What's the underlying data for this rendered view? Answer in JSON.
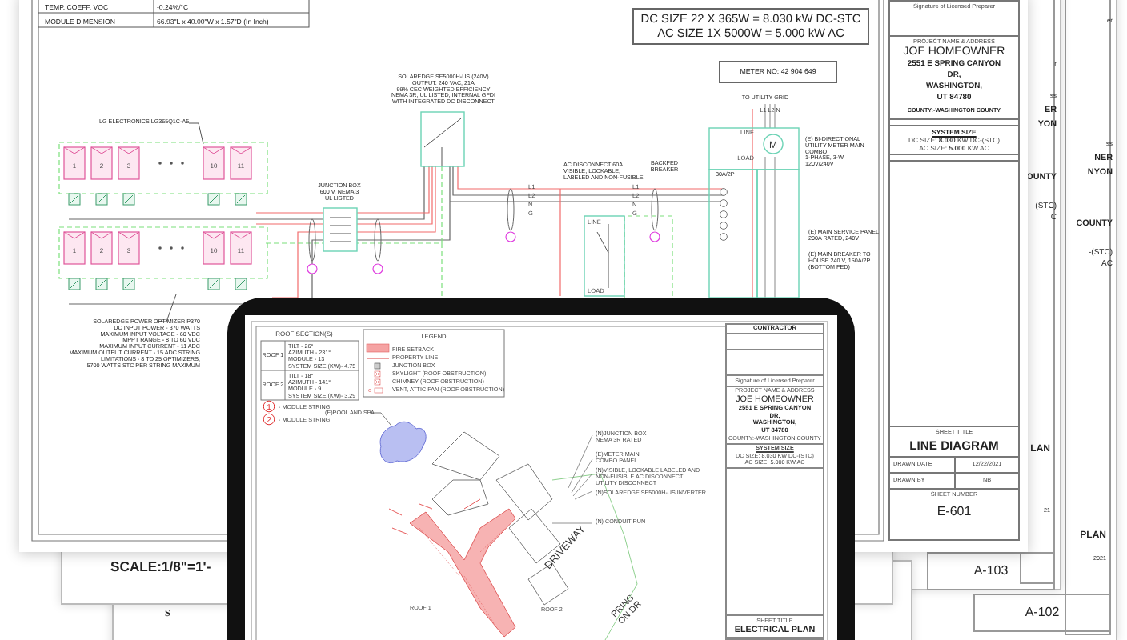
{
  "back_sheets": [
    {
      "fragments": [
        "er",
        "ss",
        "NER",
        "NYON",
        "COUNTY",
        "-(STC)",
        "AC"
      ],
      "title_fragment": "PLAN",
      "date_fragment": "2021",
      "sheet_number": "A-102"
    },
    {
      "fragments": [
        "r",
        "ss",
        "ER",
        "YON",
        "OUNTY",
        "(STC)",
        "C"
      ],
      "title_fragment": "LAN",
      "date_fragment": "21",
      "sheet_number": "A-103"
    }
  ],
  "lower_sheets": {
    "scale_note": "SCALE:1/8\"=1'-",
    "north_mark": "S"
  },
  "line_diagram": {
    "spec_table": [
      {
        "parameter": "TEMP. COEFF. VOC",
        "value": "-0.24%/°C"
      },
      {
        "parameter": "MODULE DIMENSION",
        "value": "66.93\"L x 40.00\"W x 1.57\"D (In Inch)"
      }
    ],
    "system_sizes": [
      "DC SIZE 22 X 365W = 8.030 kW DC-STC",
      "AC SIZE 1X 5000W = 5.000 kW AC"
    ],
    "meter_number": "METER NO: 42 904 649",
    "module_rows": [
      [
        "1",
        "2",
        "3",
        "10",
        "11"
      ],
      [
        "1",
        "2",
        "3",
        "10",
        "11"
      ]
    ],
    "notes": [
      {
        "lines": [
          "LG ELECTRONICS LG365Q1C-A5"
        ]
      },
      {
        "lines": [
          "SOLAREDGE SE5000H-US (240V)",
          "OUTPUT: 240 VAC, 21A",
          "99% CEC WEIGHTED EFFICIENCY",
          "NEMA 3R, UL LISTED, INTERNAL GFDI",
          "WITH INTEGRATED DC DISCONNECT"
        ]
      },
      {
        "lines": [
          "JUNCTION BOX",
          "600 V, NEMA 3",
          "UL LISTED"
        ]
      },
      {
        "lines": [
          "AC DISCONNECT 60A",
          "VISIBLE, LOCKABLE,",
          "LABELED AND NON-FUSIBLE"
        ]
      },
      {
        "lines": [
          "TO UTILITY GRID"
        ]
      },
      {
        "lines": [
          "BACKFED",
          "BREAKER"
        ]
      },
      {
        "lines": [
          "(E) BI-DIRECTIONAL",
          "UTILITY METER MAIN",
          "COMBO",
          "1-PHASE, 3-W,",
          "120V/240V"
        ]
      },
      {
        "lines": [
          "(E) MAIN SERVICE PANEL",
          "200A RATED, 240V"
        ]
      },
      {
        "lines": [
          "(E) MAIN BREAKER TO",
          "HOUSE 240 V, 150A/2P",
          "(BOTTOM FED)"
        ]
      },
      {
        "lines": [
          "SOLAREDGE POWER OPTIMIZER P370",
          "DC INPUT POWER - 370 WATTS",
          "MAXIMUM INPUT VOLTAGE - 60 VDC",
          "MPPT RANGE - 8 TO 60 VDC",
          "MAXIMUM INPUT CURRENT - 11 ADC",
          "MAXIMUM OUTPUT CURRENT - 15 ADC STRING",
          "LIMITATIONS - 8 TO 25 OPTIMIZERS,",
          "5700 WATTS STC PER STRING MAXIMUM"
        ]
      },
      {
        "lines": [
          "30A/2P"
        ]
      }
    ],
    "wire_labels_disconnect": [
      "L1",
      "L2",
      "N",
      "G"
    ],
    "wire_labels_panel": [
      "L1",
      "L2",
      "N",
      "G"
    ],
    "disconnect_labels": [
      "LINE",
      "LOAD"
    ],
    "grid_wires": "L1 L2 N",
    "meter_labels": [
      "LINE",
      "LOAD"
    ],
    "meter_symbol": "M"
  },
  "title_block": {
    "signature": "Signature of Licensed Preparer",
    "project_heading": "PROJECT NAME & ADDRESS",
    "owner": "JOE HOMEOWNER",
    "address_lines": [
      "2551 E SPRING CANYON",
      "DR,",
      "WASHINGTON,",
      "UT 84780"
    ],
    "county": "COUNTY:-WASHINGTON COUNTY",
    "system_heading": "SYSTEM SIZE",
    "dc_size": "DC SIZE: **8.030** KW DC-(STC)",
    "ac_size": "AC SIZE: **5.000** KW AC",
    "sheet_title_heading": "SHEET TITLE",
    "sheet_title": "LINE DIAGRAM",
    "drawn_date_label": "DRAWN DATE",
    "drawn_date": "12/22/2021",
    "drawn_by_label": "DRAWN BY",
    "drawn_by": "NB",
    "sheet_number_heading": "SHEET NUMBER",
    "sheet_number": "E-601"
  },
  "tablet_sheet": {
    "roof_heading": "ROOF SECTION(S)",
    "roofs": [
      {
        "name": "ROOF 1",
        "lines": [
          "TILT - 26°",
          "AZIMUTH - 231°",
          "MODULE - 13",
          "SYSTEM SIZE (KW)- 4.75"
        ]
      },
      {
        "name": "ROOF 2",
        "lines": [
          "TILT - 18°",
          "AZIMUTH - 141°",
          "MODULE - 9",
          "SYSTEM SIZE (KW)- 3.29"
        ]
      }
    ],
    "legend_heading": "LEGEND",
    "legend": [
      {
        "kind": "fill",
        "label": "FIRE SETBACK"
      },
      {
        "kind": "line",
        "label": "PROPERTY LINE"
      },
      {
        "kind": "box",
        "label": "JUNCTION BOX"
      },
      {
        "kind": "cross",
        "label": "SKYLIGHT (ROOF OBSTRUCTION)"
      },
      {
        "kind": "cross",
        "label": "CHIMNEY (ROOF OBSTRUCTION)"
      },
      {
        "kind": "vent",
        "label": "VENT, ATTIC FAN (ROOF OBSTRUCTION)"
      }
    ],
    "strings": [
      {
        "number": "1",
        "label": "- MODULE STRING"
      },
      {
        "number": "2",
        "label": "- MODULE STRING"
      }
    ],
    "pool_label": "(E)POOL AND SPA",
    "annotations": [
      {
        "lines": [
          "(N)JUNCTION BOX",
          "NEMA 3R RATED"
        ]
      },
      {
        "lines": [
          "(E)METER MAIN",
          "COMBO PANEL"
        ]
      },
      {
        "lines": [
          "(N)VISIBLE, LOCKABLE LABELED AND",
          "NON-FUSIBLE AC DISCONNECT",
          "UTILITY DISCONNECT"
        ]
      },
      {
        "lines": [
          "(N)SOLAREDGE SE5000H-US INVERTER"
        ]
      },
      {
        "lines": [
          "(N) CONDUIT RUN"
        ]
      }
    ],
    "driveway": "DRIVEWAY",
    "roof_labels": [
      "ROOF 1",
      "ROOF 2"
    ],
    "street_lines": [
      "PRING",
      "ON DR"
    ],
    "title_block": {
      "contractor_heading": "CONTRACTOR",
      "signature": "Signature of Licensed Preparer",
      "project_heading": "PROJECT NAME & ADDRESS",
      "owner": "JOE HOMEOWNER",
      "address_lines": [
        "2551 E SPRING CANYON",
        "DR,",
        "WASHINGTON,",
        "UT 84780"
      ],
      "county": "COUNTY:-WASHINGTON COUNTY",
      "system_heading": "SYSTEM SIZE",
      "dc_size": "DC SIZE: 8.030 KW DC-(STC)",
      "ac_size": "AC SIZE: 5.000 KW AC",
      "sheet_title_heading": "SHEET TITLE",
      "sheet_title": "ELECTRICAL PLAN"
    }
  }
}
